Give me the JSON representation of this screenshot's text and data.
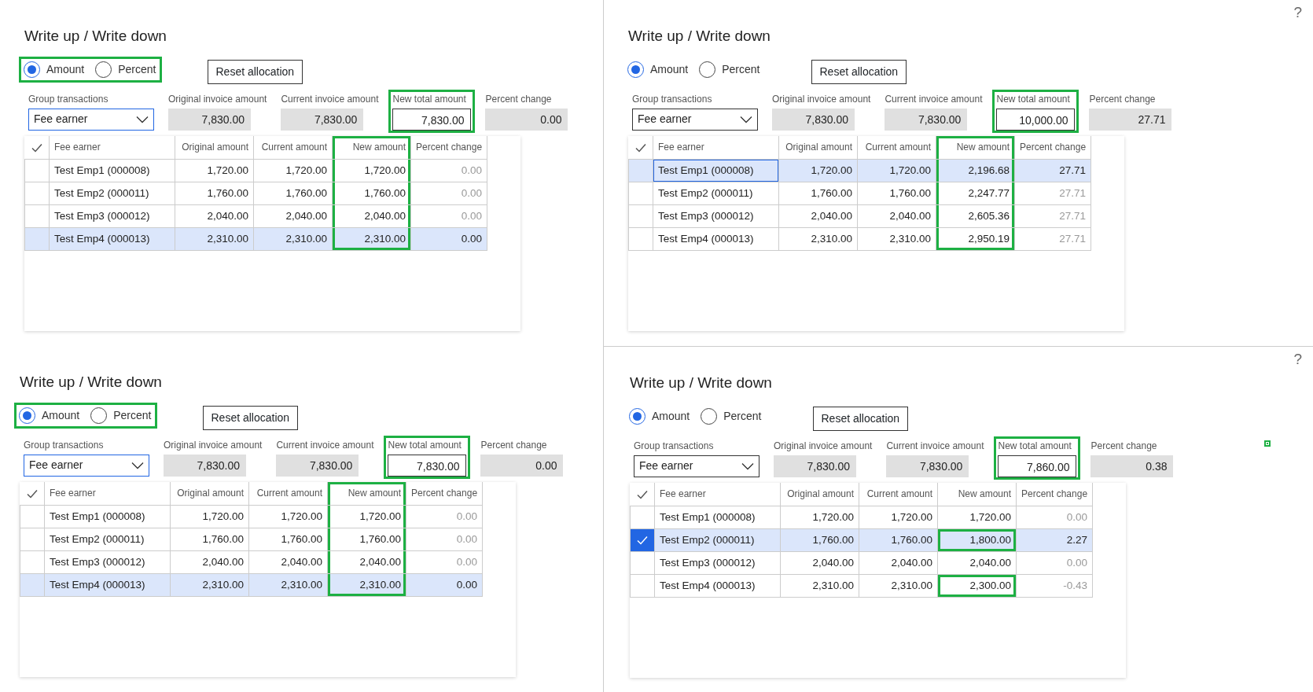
{
  "panels": [
    {
      "title": "Write up / Write down",
      "radios": [
        {
          "label": "Amount",
          "selected": true
        },
        {
          "label": "Percent",
          "selected": false
        }
      ],
      "radio_highlight": true,
      "reset_button": "Reset allocation",
      "group_transactions": {
        "label": "Group transactions",
        "value": "Fee earner",
        "focused": true
      },
      "amounts": [
        {
          "label": "Original invoice amount",
          "value": "7,830.00",
          "editable": false,
          "highlight": false
        },
        {
          "label": "Current invoice amount",
          "value": "7,830.00",
          "editable": false,
          "highlight": false
        },
        {
          "label": "New total amount",
          "value": "7,830.00",
          "editable": true,
          "highlight": true
        },
        {
          "label": "Percent change",
          "value": "0.00",
          "editable": false,
          "highlight": false
        }
      ],
      "columns": [
        {
          "label": "Fee earner",
          "highlight": false
        },
        {
          "label": "Original amount",
          "highlight": false
        },
        {
          "label": "Current amount",
          "highlight": false
        },
        {
          "label": "New amount",
          "highlight": true
        },
        {
          "label": "Percent change",
          "highlight": false
        }
      ],
      "rows": [
        {
          "fee_earner": "Test Emp1 (000008)",
          "original_amount": "1,720.00",
          "current_amount": "1,720.00",
          "new_amount": "1,720.00",
          "percent_change": "0.00",
          "selected": false,
          "checked": false,
          "focused": false,
          "new_highlighted": false
        },
        {
          "fee_earner": "Test Emp2 (000011)",
          "original_amount": "1,760.00",
          "current_amount": "1,760.00",
          "new_amount": "1,760.00",
          "percent_change": "0.00",
          "selected": false,
          "checked": false,
          "focused": false,
          "new_highlighted": false
        },
        {
          "fee_earner": "Test Emp3 (000012)",
          "original_amount": "2,040.00",
          "current_amount": "2,040.00",
          "new_amount": "2,040.00",
          "percent_change": "0.00",
          "selected": false,
          "checked": false,
          "focused": false,
          "new_highlighted": false
        },
        {
          "fee_earner": "Test Emp4 (000013)",
          "original_amount": "2,310.00",
          "current_amount": "2,310.00",
          "new_amount": "2,310.00",
          "percent_change": "0.00",
          "selected": true,
          "checked": false,
          "focused": false,
          "new_highlighted": false
        }
      ]
    },
    {
      "help": "?",
      "title": "Write up / Write down",
      "radios": [
        {
          "label": "Amount",
          "selected": true
        },
        {
          "label": "Percent",
          "selected": false
        }
      ],
      "radio_highlight": false,
      "reset_button": "Reset allocation",
      "group_transactions": {
        "label": "Group transactions",
        "value": "Fee earner",
        "focused": false
      },
      "amounts": [
        {
          "label": "Original invoice amount",
          "value": "7,830.00",
          "editable": false,
          "highlight": false
        },
        {
          "label": "Current invoice amount",
          "value": "7,830.00",
          "editable": false,
          "highlight": false
        },
        {
          "label": "New total amount",
          "value": "10,000.00",
          "editable": true,
          "highlight": true
        },
        {
          "label": "Percent change",
          "value": "27.71",
          "editable": false,
          "highlight": false
        }
      ],
      "columns": [
        {
          "label": "Fee earner",
          "highlight": false
        },
        {
          "label": "Original amount",
          "highlight": false
        },
        {
          "label": "Current amount",
          "highlight": false
        },
        {
          "label": "New amount",
          "highlight": true
        },
        {
          "label": "Percent change",
          "highlight": false
        }
      ],
      "rows": [
        {
          "fee_earner": "Test Emp1 (000008)",
          "original_amount": "1,720.00",
          "current_amount": "1,720.00",
          "new_amount": "2,196.68",
          "percent_change": "27.71",
          "selected": true,
          "checked": false,
          "focused": true,
          "new_highlighted": false
        },
        {
          "fee_earner": "Test Emp2 (000011)",
          "original_amount": "1,760.00",
          "current_amount": "1,760.00",
          "new_amount": "2,247.77",
          "percent_change": "27.71",
          "selected": false,
          "checked": false,
          "focused": false,
          "new_highlighted": false
        },
        {
          "fee_earner": "Test Emp3 (000012)",
          "original_amount": "2,040.00",
          "current_amount": "2,040.00",
          "new_amount": "2,605.36",
          "percent_change": "27.71",
          "selected": false,
          "checked": false,
          "focused": false,
          "new_highlighted": false
        },
        {
          "fee_earner": "Test Emp4 (000013)",
          "original_amount": "2,310.00",
          "current_amount": "2,310.00",
          "new_amount": "2,950.19",
          "percent_change": "27.71",
          "selected": false,
          "checked": false,
          "focused": false,
          "new_highlighted": false
        }
      ]
    },
    {
      "title": "Write up / Write down",
      "radios": [
        {
          "label": "Amount",
          "selected": true
        },
        {
          "label": "Percent",
          "selected": false
        }
      ],
      "radio_highlight": true,
      "reset_button": "Reset allocation",
      "group_transactions": {
        "label": "Group transactions",
        "value": "Fee earner",
        "focused": true
      },
      "amounts": [
        {
          "label": "Original invoice amount",
          "value": "7,830.00",
          "editable": false,
          "highlight": false
        },
        {
          "label": "Current invoice amount",
          "value": "7,830.00",
          "editable": false,
          "highlight": false
        },
        {
          "label": "New total amount",
          "value": "7,830.00",
          "editable": true,
          "highlight": true
        },
        {
          "label": "Percent change",
          "value": "0.00",
          "editable": false,
          "highlight": false
        }
      ],
      "columns": [
        {
          "label": "Fee earner",
          "highlight": false
        },
        {
          "label": "Original amount",
          "highlight": false
        },
        {
          "label": "Current amount",
          "highlight": false
        },
        {
          "label": "New amount",
          "highlight": true
        },
        {
          "label": "Percent change",
          "highlight": false
        }
      ],
      "rows": [
        {
          "fee_earner": "Test Emp1 (000008)",
          "original_amount": "1,720.00",
          "current_amount": "1,720.00",
          "new_amount": "1,720.00",
          "percent_change": "0.00",
          "selected": false,
          "checked": false,
          "focused": false,
          "new_highlighted": false
        },
        {
          "fee_earner": "Test Emp2 (000011)",
          "original_amount": "1,760.00",
          "current_amount": "1,760.00",
          "new_amount": "1,760.00",
          "percent_change": "0.00",
          "selected": false,
          "checked": false,
          "focused": false,
          "new_highlighted": false
        },
        {
          "fee_earner": "Test Emp3 (000012)",
          "original_amount": "2,040.00",
          "current_amount": "2,040.00",
          "new_amount": "2,040.00",
          "percent_change": "0.00",
          "selected": false,
          "checked": false,
          "focused": false,
          "new_highlighted": false
        },
        {
          "fee_earner": "Test Emp4 (000013)",
          "original_amount": "2,310.00",
          "current_amount": "2,310.00",
          "new_amount": "2,310.00",
          "percent_change": "0.00",
          "selected": true,
          "checked": false,
          "focused": false,
          "new_highlighted": false
        }
      ]
    },
    {
      "help": "?",
      "marker": true,
      "title": "Write up / Write down",
      "radios": [
        {
          "label": "Amount",
          "selected": true
        },
        {
          "label": "Percent",
          "selected": false
        }
      ],
      "radio_highlight": false,
      "reset_button": "Reset allocation",
      "group_transactions": {
        "label": "Group transactions",
        "value": "Fee earner",
        "focused": false
      },
      "amounts": [
        {
          "label": "Original invoice amount",
          "value": "7,830.00",
          "editable": false,
          "highlight": false
        },
        {
          "label": "Current invoice amount",
          "value": "7,830.00",
          "editable": false,
          "highlight": false
        },
        {
          "label": "New total amount",
          "value": "7,860.00",
          "editable": true,
          "highlight": true
        },
        {
          "label": "Percent change",
          "value": "0.38",
          "editable": false,
          "highlight": false
        }
      ],
      "columns": [
        {
          "label": "Fee earner",
          "highlight": false
        },
        {
          "label": "Original amount",
          "highlight": false
        },
        {
          "label": "Current amount",
          "highlight": false
        },
        {
          "label": "New amount",
          "highlight": false
        },
        {
          "label": "Percent change",
          "highlight": false
        }
      ],
      "rows": [
        {
          "fee_earner": "Test Emp1 (000008)",
          "original_amount": "1,720.00",
          "current_amount": "1,720.00",
          "new_amount": "1,720.00",
          "percent_change": "0.00",
          "selected": false,
          "checked": false,
          "focused": false,
          "new_highlighted": false
        },
        {
          "fee_earner": "Test Emp2 (000011)",
          "original_amount": "1,760.00",
          "current_amount": "1,760.00",
          "new_amount": "1,800.00",
          "percent_change": "2.27",
          "selected": true,
          "checked": true,
          "focused": false,
          "new_highlighted": true
        },
        {
          "fee_earner": "Test Emp3 (000012)",
          "original_amount": "2,040.00",
          "current_amount": "2,040.00",
          "new_amount": "2,040.00",
          "percent_change": "0.00",
          "selected": false,
          "checked": false,
          "focused": false,
          "new_highlighted": false
        },
        {
          "fee_earner": "Test Emp4 (000013)",
          "original_amount": "2,310.00",
          "current_amount": "2,310.00",
          "new_amount": "2,300.00",
          "percent_change": "-0.43",
          "selected": false,
          "checked": false,
          "focused": false,
          "new_highlighted": true
        }
      ]
    }
  ]
}
